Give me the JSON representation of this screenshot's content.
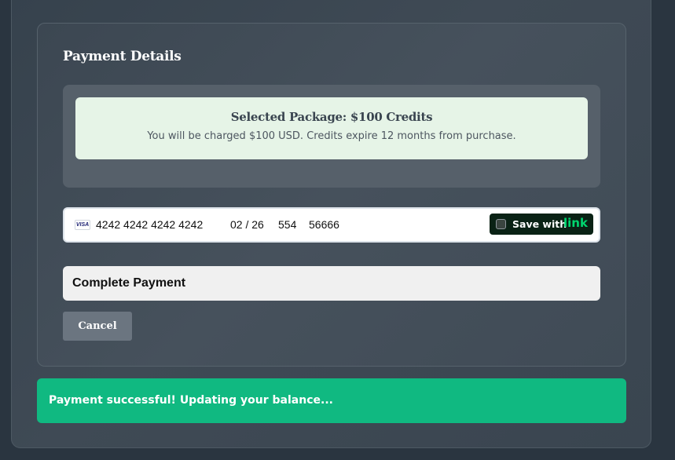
{
  "payment": {
    "title": "Payment Details",
    "package": {
      "title": "Selected Package: $100 Credits",
      "description": "You will be charged $100 USD. Credits expire 12 months from purchase."
    },
    "card": {
      "brand": "VISA",
      "number": "4242 4242 4242 4242",
      "expiry": "02 / 26",
      "cvc": "554",
      "zip": "56666",
      "save_label": "Save with",
      "save_brand": "link",
      "save_checked": false
    },
    "complete_label": "Complete Payment",
    "cancel_label": "Cancel"
  },
  "status": {
    "message": "Payment successful! Updating your balance..."
  },
  "colors": {
    "success": "#10b981",
    "link_brand": "#00d66f",
    "notice_background": "#e6f4e7"
  }
}
